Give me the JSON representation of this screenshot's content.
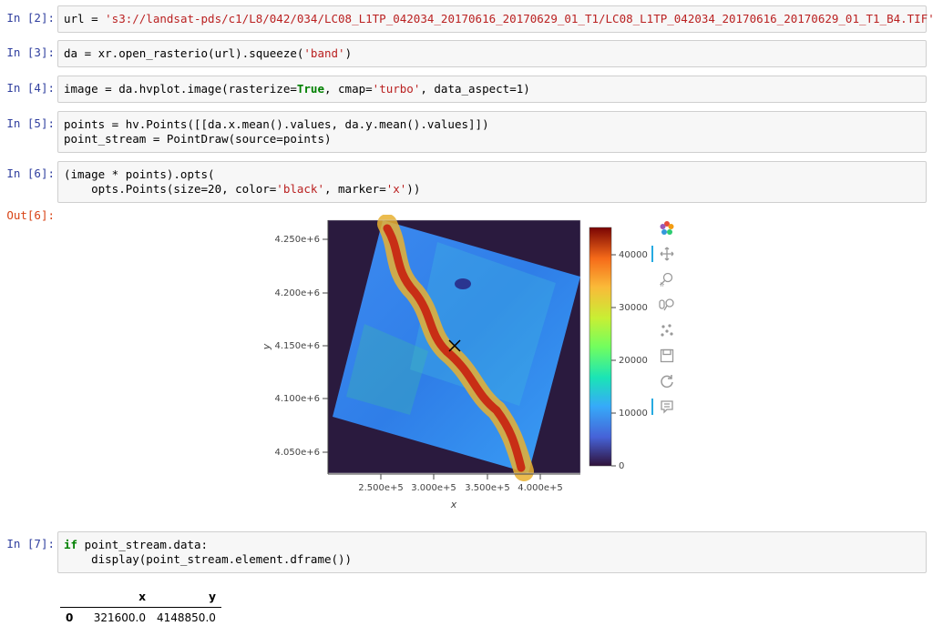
{
  "cells": [
    {
      "prompt": "In [2]:",
      "code_parts": [
        [
          "url = ",
          ""
        ],
        [
          "'s3://landsat-pds/c1/L8/042/034/LC08_L1TP_042034_20170616_20170629_01_T1/LC08_L1TP_042034_20170616_20170629_01_T1_B4.TIF'",
          "str"
        ]
      ]
    },
    {
      "prompt": "In [3]:",
      "code_parts": [
        [
          "da = xr.open_rasterio(url).squeeze(",
          ""
        ],
        [
          "'band'",
          "str"
        ],
        [
          ")",
          ""
        ]
      ]
    },
    {
      "prompt": "In [4]:",
      "code_parts": [
        [
          "image = da.hvplot.image(rasterize=",
          ""
        ],
        [
          "True",
          "kw"
        ],
        [
          ", cmap=",
          ""
        ],
        [
          "'turbo'",
          "str"
        ],
        [
          ", data_aspect=1)",
          ""
        ]
      ]
    },
    {
      "prompt": "In [5]:",
      "code_parts": [
        [
          "points = hv.Points([[da.x.mean().values, da.y.mean().values]])\npoint_stream = PointDraw(source=points)",
          ""
        ]
      ]
    },
    {
      "prompt": "In [6]:",
      "code_parts": [
        [
          "(image * points).opts(\n    opts.Points(size=20, color=",
          ""
        ],
        [
          "'black'",
          "str"
        ],
        [
          ", marker=",
          ""
        ],
        [
          "'x'",
          "str"
        ],
        [
          "))",
          ""
        ]
      ]
    },
    {
      "prompt": "In [7]:",
      "code_parts": [
        [
          "if",
          "kw"
        ],
        [
          " point_stream.data:\n    display(point_stream.element.dframe())",
          ""
        ]
      ]
    }
  ],
  "out_prompt": "Out[6]:",
  "plot": {
    "y_ticks": [
      "4.250e+6",
      "4.200e+6",
      "4.150e+6",
      "4.100e+6",
      "4.050e+6"
    ],
    "x_ticks": [
      "2.500e+5",
      "3.000e+5",
      "3.500e+5",
      "4.000e+5"
    ],
    "xlabel": "x",
    "ylabel": "y",
    "colorbar_ticks": [
      "40000",
      "30000",
      "20000",
      "10000",
      "0"
    ],
    "background_color": "#2a1a3e",
    "marker": "x"
  },
  "toolbar": {
    "icons": [
      "bokeh-logo-icon",
      "pan-icon",
      "box-zoom-icon",
      "wheel-zoom-icon",
      "point-draw-icon",
      "save-icon",
      "reset-icon",
      "hover-icon"
    ]
  },
  "dataframe": {
    "columns": [
      "x",
      "y"
    ],
    "rows": [
      {
        "index": "0",
        "x": "321600.0",
        "y": "4148850.0"
      }
    ]
  }
}
